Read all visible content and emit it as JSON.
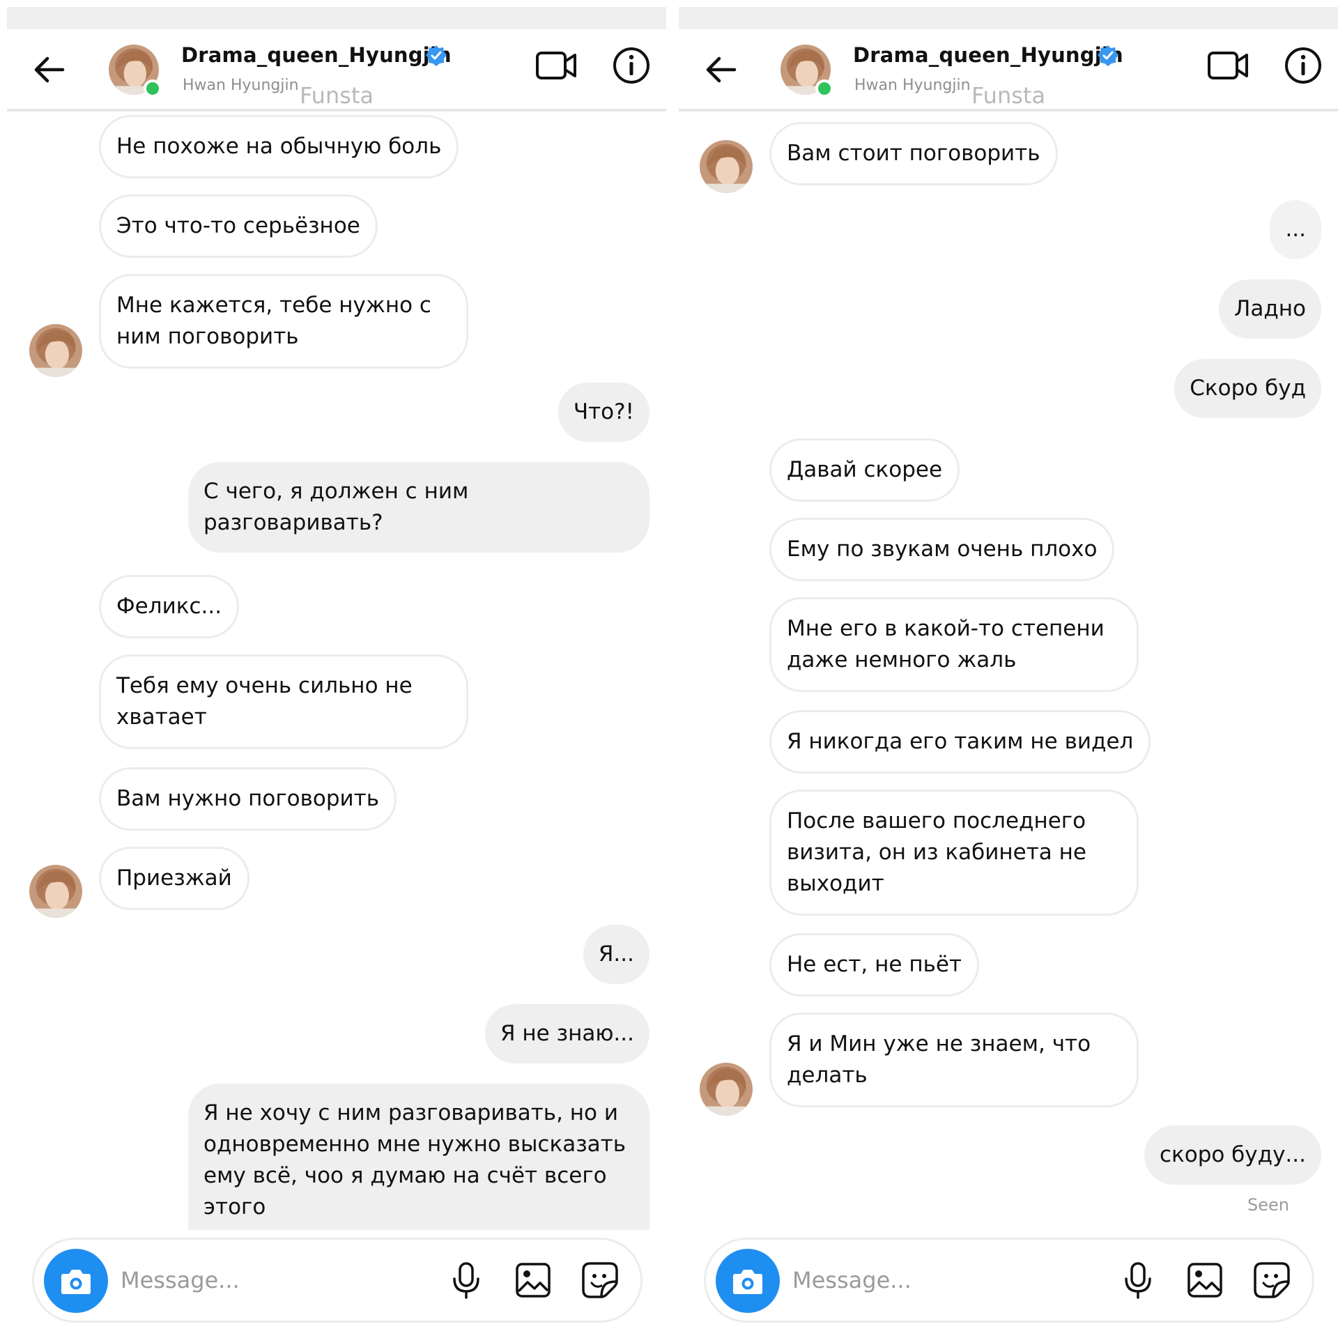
{
  "header": {
    "username": "Drama_queen_Hyungjin",
    "subtitle": "Hwan Hyungjin",
    "watermark": "Funsta"
  },
  "composer": {
    "placeholder": "Message..."
  },
  "left": {
    "messages": [
      {
        "from": "them",
        "text": "Не похоже на обычную боль"
      },
      {
        "from": "them",
        "text": "Это что-то серьёзное"
      },
      {
        "from": "them",
        "text": "Мне кажется, тебе нужно с\nним поговорить"
      },
      {
        "from": "me",
        "text": "Что?!"
      },
      {
        "from": "me",
        "text": "С чего, я должен с ним\nразговаривать?"
      },
      {
        "from": "them",
        "text": "Феликс..."
      },
      {
        "from": "them",
        "text": "Тебя ему очень сильно не\nхватает"
      },
      {
        "from": "them",
        "text": "Вам нужно поговорить"
      },
      {
        "from": "them",
        "text": "Приезжай"
      },
      {
        "from": "me",
        "text": "Я..."
      },
      {
        "from": "me",
        "text": "Я не знаю..."
      },
      {
        "from": "me",
        "text": "Я не хочу с ним разговаривать, но и\nодновременно мне нужно высказать\nему всё, чоо я думаю на счёт всего\nэтого"
      }
    ]
  },
  "right": {
    "messages": [
      {
        "from": "them",
        "text": "Вам стоит поговорить"
      },
      {
        "from": "me",
        "text": "..."
      },
      {
        "from": "me",
        "text": "Ладно"
      },
      {
        "from": "me",
        "text": "Скоро буд"
      },
      {
        "from": "them",
        "text": "Давай скорее"
      },
      {
        "from": "them",
        "text": "Ему по звукам очень плохо"
      },
      {
        "from": "them",
        "text": "Мне его в какой-то степени\nдаже немного жаль"
      },
      {
        "from": "them",
        "text": "Я никогда его таким не видел"
      },
      {
        "from": "them",
        "text": "После вашего последнего\nвизита, он из кабинета не\nвыходит"
      },
      {
        "from": "them",
        "text": "Не ест, не пьёт"
      },
      {
        "from": "them",
        "text": "Я и Мин уже не знаем, что\nделать"
      },
      {
        "from": "me",
        "text": "скоро буду..."
      }
    ],
    "seen": "Seen"
  },
  "colors": {
    "accent": "#1f8ef1",
    "verified": "#3897f0",
    "online": "#2fc25b",
    "outgoing_bubble": "#efefef",
    "incoming_border": "#ececec"
  },
  "icons": [
    "back-arrow-icon",
    "verified-badge-icon",
    "video-call-icon",
    "info-icon",
    "camera-icon",
    "microphone-icon",
    "gallery-icon",
    "sticker-icon"
  ]
}
